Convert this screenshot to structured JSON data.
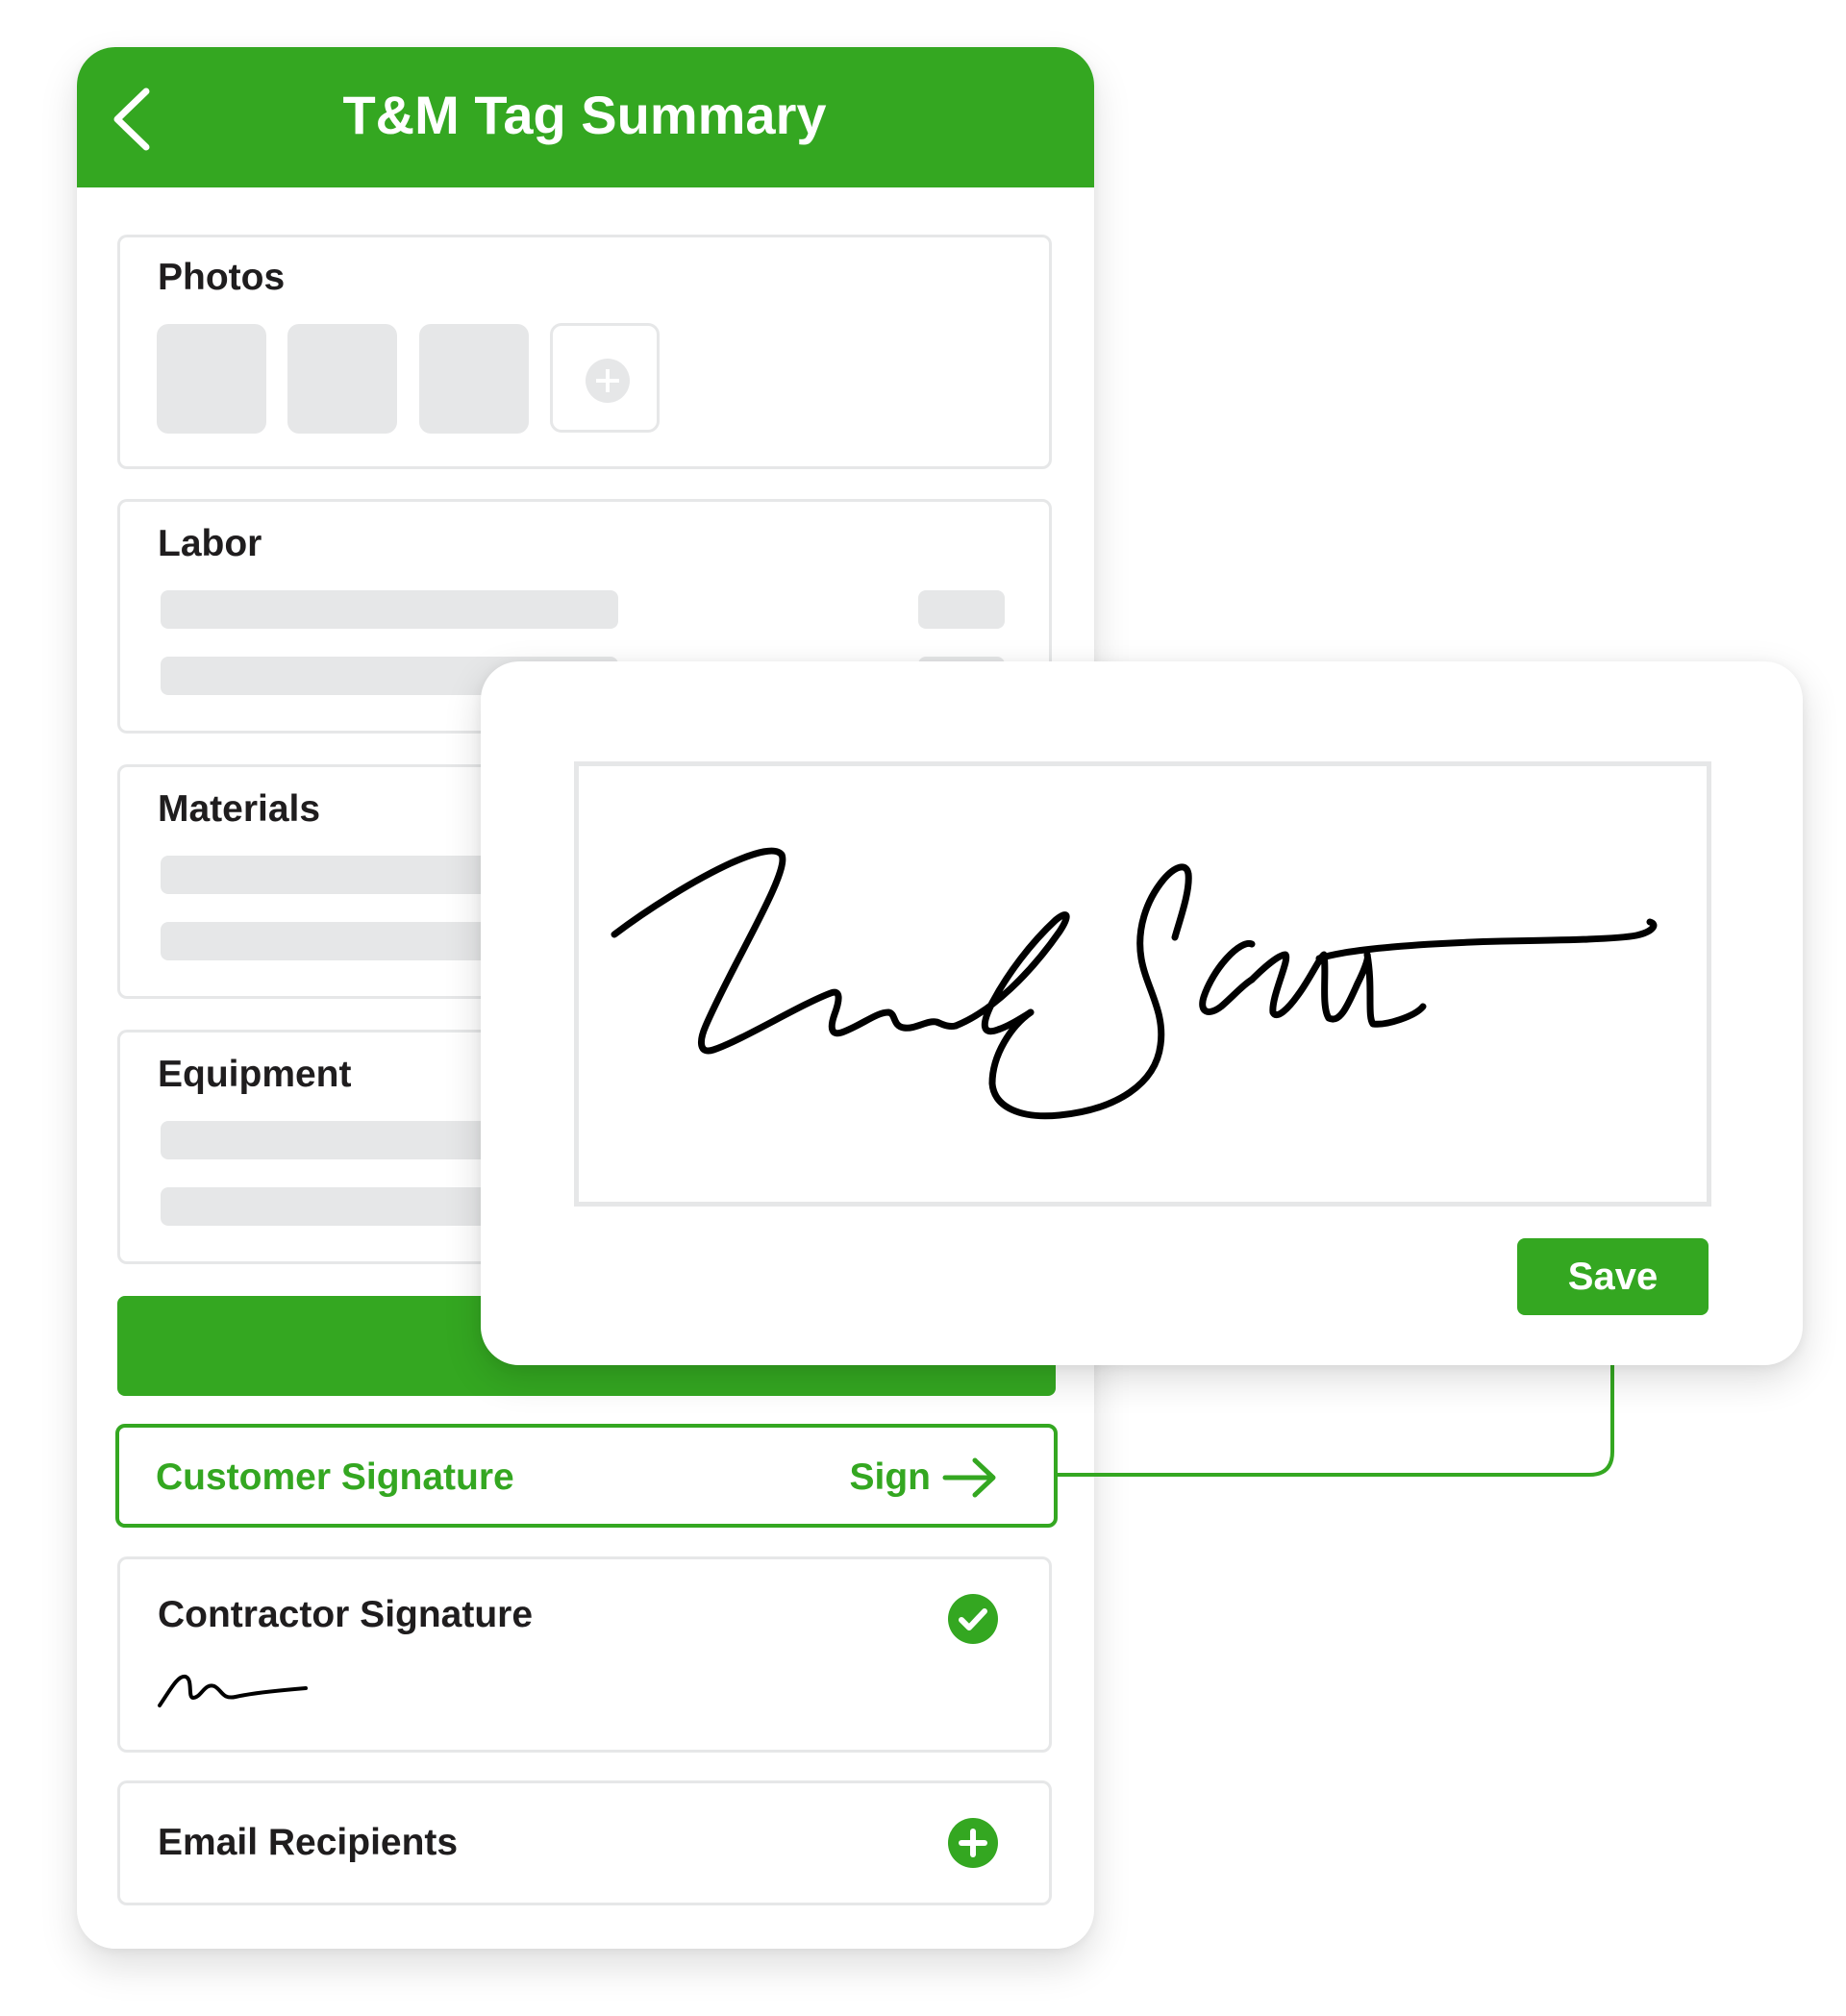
{
  "header": {
    "title": "T&M Tag Summary",
    "back_icon": "chevron-left-icon"
  },
  "sections": {
    "photos": {
      "title": "Photos",
      "thumbnail_count": 3,
      "add_icon": "plus-circle-icon"
    },
    "labor": {
      "title": "Labor"
    },
    "materials": {
      "title": "Materials"
    },
    "equipment": {
      "title": "Equipment"
    }
  },
  "customer_signature": {
    "label": "Customer Signature",
    "action_label": "Sign",
    "action_icon": "arrow-right-icon"
  },
  "contractor_signature": {
    "label": "Contractor Signature",
    "status_icon": "check-circle-icon",
    "status": "signed"
  },
  "email_recipients": {
    "label": "Email Recipients",
    "add_icon": "plus-circle-icon"
  },
  "signature_modal": {
    "save_label": "Save",
    "signature_present": true
  },
  "colors": {
    "brand_green": "#34a721",
    "skeleton_gray": "#e6e7e8",
    "text_dark": "#1f1d1e",
    "white": "#ffffff"
  }
}
